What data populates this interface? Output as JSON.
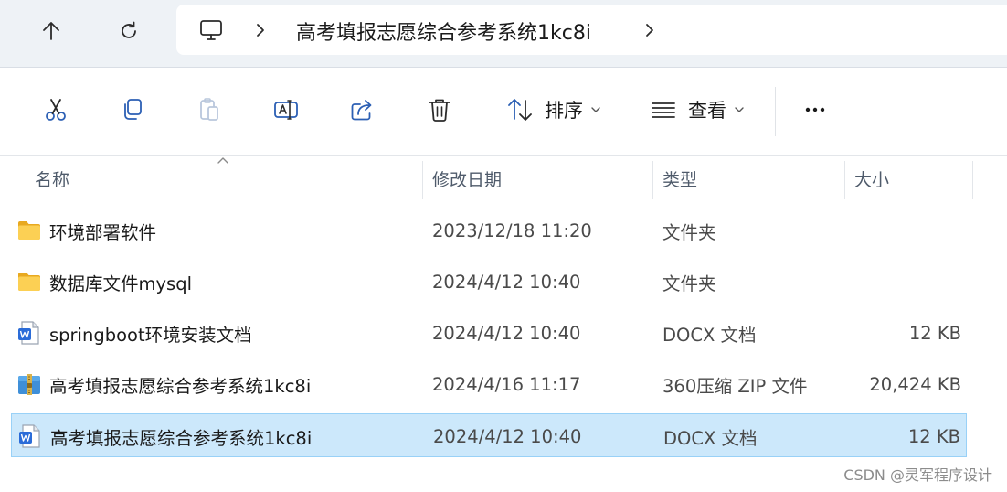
{
  "address_bar": {
    "path": "高考填报志愿综合参考系统1kc8i"
  },
  "toolbar": {
    "sort_label": "排序",
    "view_label": "查看"
  },
  "columns": {
    "name": "名称",
    "date": "修改日期",
    "type": "类型",
    "size": "大小"
  },
  "files": [
    {
      "name": "环境部署软件",
      "date": "2023/12/18 11:20",
      "type": "文件夹",
      "size": "",
      "icon": "folder-icon",
      "selected": false
    },
    {
      "name": "数据库文件mysql",
      "date": "2024/4/12 10:40",
      "type": "文件夹",
      "size": "",
      "icon": "folder-icon",
      "selected": false
    },
    {
      "name": "springboot环境安装文档",
      "date": "2024/4/12 10:40",
      "type": "DOCX 文档",
      "size": "12 KB",
      "icon": "word-doc-icon",
      "selected": false
    },
    {
      "name": "高考填报志愿综合参考系统1kc8i",
      "date": "2024/4/16 11:17",
      "type": "360压缩 ZIP 文件",
      "size": "20,424 KB",
      "icon": "zip-archive-icon",
      "selected": false
    },
    {
      "name": "高考填报志愿综合参考系统1kc8i",
      "date": "2024/4/12 10:40",
      "type": "DOCX 文档",
      "size": "12 KB",
      "icon": "word-doc-icon",
      "selected": true
    }
  ],
  "watermark": "CSDN @灵军程序设计",
  "colors": {
    "selection_bg": "#cce8fb",
    "folder": "#f8c33a",
    "word_blue": "#2b6cd8",
    "accent": "#0067c0"
  }
}
